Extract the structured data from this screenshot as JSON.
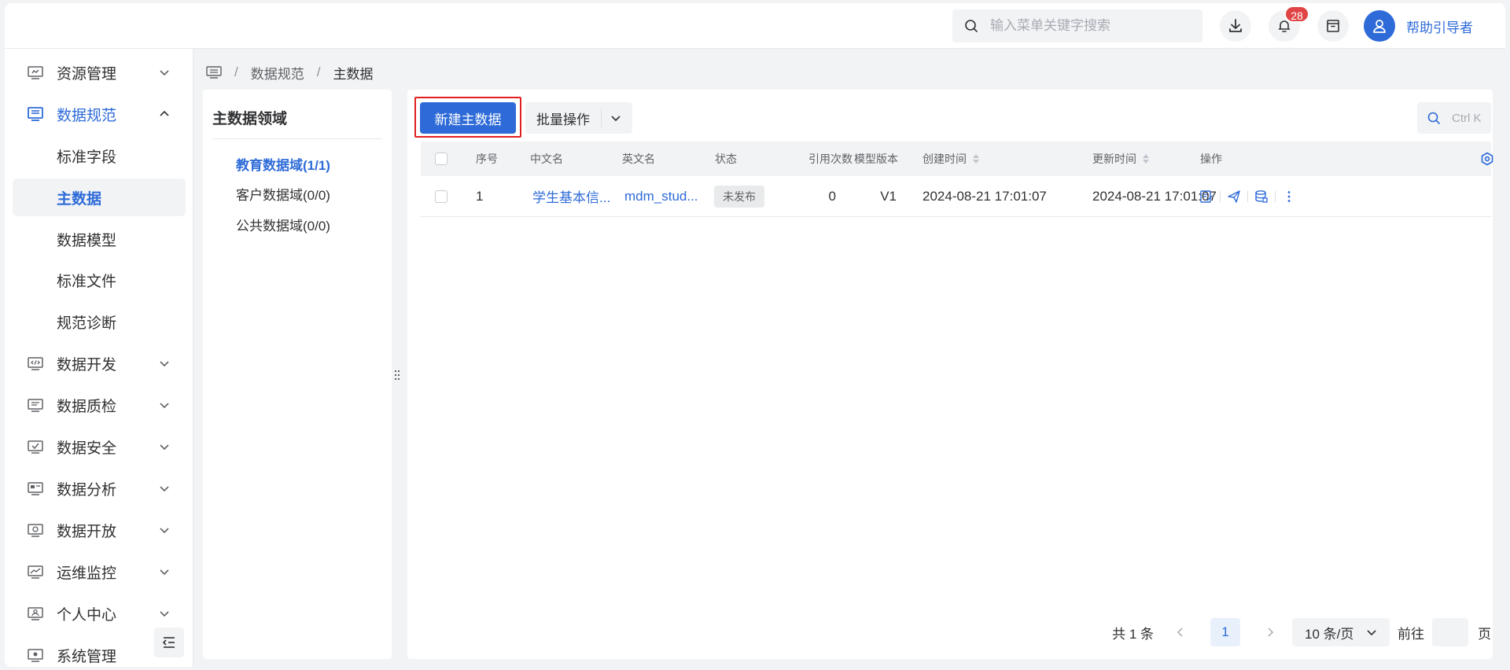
{
  "header": {
    "search_placeholder": "输入菜单关键字搜索",
    "notification_count": "28",
    "username": "帮助引导者"
  },
  "sidebar": {
    "items": [
      {
        "label": "资源管理",
        "icon": "resource-icon",
        "expanded": false
      },
      {
        "label": "数据规范",
        "icon": "data-spec-icon",
        "expanded": true
      },
      {
        "label": "数据开发",
        "icon": "code-icon",
        "expanded": false
      },
      {
        "label": "数据质检",
        "icon": "quality-icon",
        "expanded": false
      },
      {
        "label": "数据安全",
        "icon": "security-icon",
        "expanded": false
      },
      {
        "label": "数据分析",
        "icon": "analysis-icon",
        "expanded": false
      },
      {
        "label": "数据开放",
        "icon": "open-icon",
        "expanded": false
      },
      {
        "label": "运维监控",
        "icon": "monitor-icon",
        "expanded": false
      },
      {
        "label": "个人中心",
        "icon": "user-center-icon",
        "expanded": false
      },
      {
        "label": "系统管理",
        "icon": "system-icon",
        "expanded": false
      }
    ],
    "sub_items": [
      {
        "label": "标准字段"
      },
      {
        "label": "主数据",
        "selected": true
      },
      {
        "label": "数据模型"
      },
      {
        "label": "标准文件"
      },
      {
        "label": "规范诊断"
      }
    ]
  },
  "breadcrumb": {
    "parent": "数据规范",
    "current": "主数据",
    "separator": "/"
  },
  "domains": {
    "title": "主数据领域",
    "items": [
      {
        "label": "教育数据域(1/1)",
        "active": true
      },
      {
        "label": "客户数据域(0/0)"
      },
      {
        "label": "公共数据域(0/0)"
      }
    ]
  },
  "toolbar": {
    "new_label": "新建主数据",
    "batch_label": "批量操作",
    "search_shortcut": "Ctrl K"
  },
  "table": {
    "columns": [
      "序号",
      "中文名",
      "英文名",
      "状态",
      "引用次数",
      "模型版本",
      "创建时间",
      "更新时间",
      "操作"
    ],
    "rows": [
      {
        "index": "1",
        "cn_name": "学生基本信...",
        "en_name": "mdm_stud...",
        "status": "未发布",
        "ref_count": "0",
        "version": "V1",
        "created": "2024-08-21 17:01:07",
        "updated": "2024-08-21 17:01:07"
      }
    ]
  },
  "pagination": {
    "total": "共 1 条",
    "current_page": "1",
    "page_size": "10 条/页",
    "goto_label": "前往",
    "page_label": "页"
  },
  "colors": {
    "primary": "#2e6bd8",
    "badge": "#e04444",
    "highlight": "#e02020"
  }
}
